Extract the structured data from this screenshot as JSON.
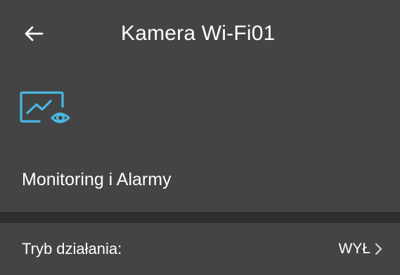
{
  "header": {
    "title": "Kamera Wi-Fi01",
    "back_icon": "arrow-left-icon"
  },
  "section": {
    "icon": "chart-eye-monitoring-icon",
    "title": "Monitoring i Alarmy"
  },
  "settings": [
    {
      "label": "Tryb działania:",
      "value": "WYŁ"
    }
  ],
  "colors": {
    "background": "#444444",
    "divider": "#2f2f2f",
    "accent": "#49b9e3",
    "text": "#ffffff"
  }
}
